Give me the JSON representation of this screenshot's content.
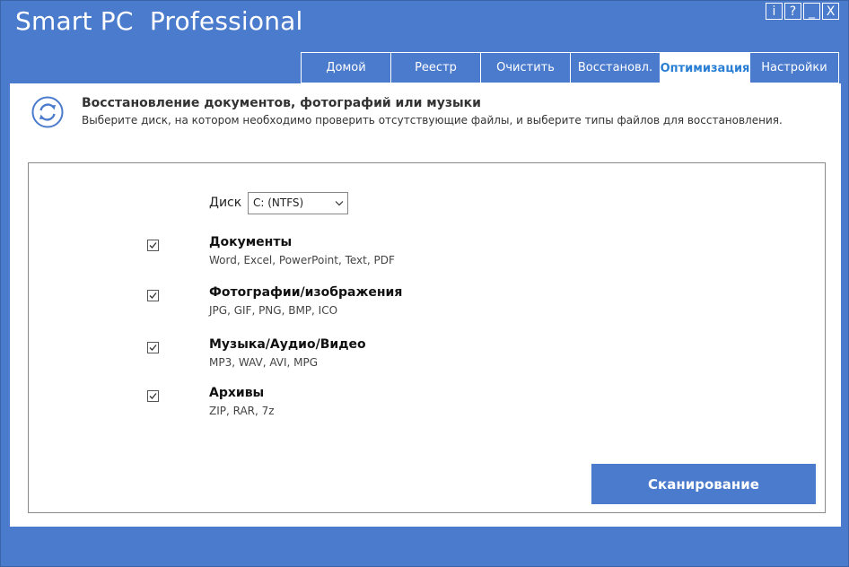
{
  "app": {
    "title": "Smart PC  Professional"
  },
  "window_buttons": [
    {
      "label": "i",
      "name": "info-button"
    },
    {
      "label": "?",
      "name": "help-button"
    },
    {
      "label": "_",
      "name": "minimize-button"
    },
    {
      "label": "X",
      "name": "close-button"
    }
  ],
  "tabs": [
    {
      "label": "Домой",
      "active": false
    },
    {
      "label": "Реестр",
      "active": false
    },
    {
      "label": "Очистить",
      "active": false
    },
    {
      "label": "Восстановл.",
      "active": false
    },
    {
      "label": "Оптимизация",
      "active": true
    },
    {
      "label": "Настройки",
      "active": false
    }
  ],
  "header": {
    "icon": "restore-cycle-icon",
    "title": "Восстановление документов, фотографий или музыки",
    "subtitle": "Выберите диск, на котором необходимо проверить отсутствующие файлы, и выберите типы файлов для восстановления."
  },
  "disk": {
    "label": "Диск",
    "selected": "C: (NTFS)"
  },
  "categories": [
    {
      "title": "Документы",
      "desc": "Word, Excel, PowerPoint, Text, PDF",
      "checked": true
    },
    {
      "title": "Фотографии/изображения",
      "desc": "JPG, GIF, PNG, BMP, ICO",
      "checked": true
    },
    {
      "title": "Музыка/Аудио/Видео",
      "desc": "MP3, WAV, AVI, MPG",
      "checked": true
    },
    {
      "title": "Архивы",
      "desc": "ZIP, RAR, 7z",
      "checked": true
    }
  ],
  "scan_button": {
    "label": "Сканирование"
  },
  "colors": {
    "accent": "#4b7bcc",
    "active_tab_text": "#2a7fd4"
  }
}
